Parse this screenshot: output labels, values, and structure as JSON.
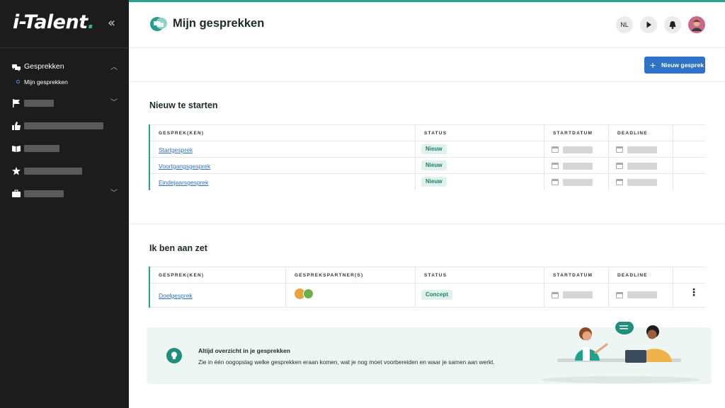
{
  "app": {
    "logo_text": "i-Talent",
    "logo_dot": "."
  },
  "sidebar": {
    "collapse_icon": "«",
    "items": [
      {
        "label": "Gesprekken",
        "icon": "chat-bubbles-icon",
        "expanded": true
      },
      {
        "sub_label": "Mijn gesprekken"
      }
    ]
  },
  "header": {
    "title": "Mijn gesprekken",
    "language": "NL",
    "icons": [
      "play-icon",
      "bell-icon",
      "user-avatar"
    ]
  },
  "actions": {
    "new_conversation": "Nieuw gesprek"
  },
  "section_new": {
    "title": "Nieuw te starten",
    "columns": [
      "GESPREK(KEN)",
      "STATUS",
      "STARTDATUM",
      "DEADLINE"
    ],
    "rows": [
      {
        "name": "Startgesprek",
        "status": "Nieuw"
      },
      {
        "name": "Voortgangsgesprek",
        "status": "Nieuw"
      },
      {
        "name": "Eindejaarsgesprek",
        "status": "Nieuw"
      }
    ]
  },
  "section_turn": {
    "title": "Ik ben aan zet",
    "columns": [
      "GESPREK(KEN)",
      "GESPREKSPARTNER(S)",
      "STATUS",
      "STARTDATUM",
      "DEADLINE"
    ],
    "rows": [
      {
        "name": "Doelgesprek",
        "status": "Concept"
      }
    ]
  },
  "banner": {
    "title": "Altijd overzicht in je gesprekken",
    "text": "Zie in één oogopslag welke gesprekken eraan komen, wat je nog moet voorbereiden en waar je samen aan werkt."
  },
  "colors": {
    "accent": "#26a58f",
    "primary": "#2f73c9",
    "sidebar": "#1c1c1c",
    "badge_bg": "#dff2ee"
  }
}
